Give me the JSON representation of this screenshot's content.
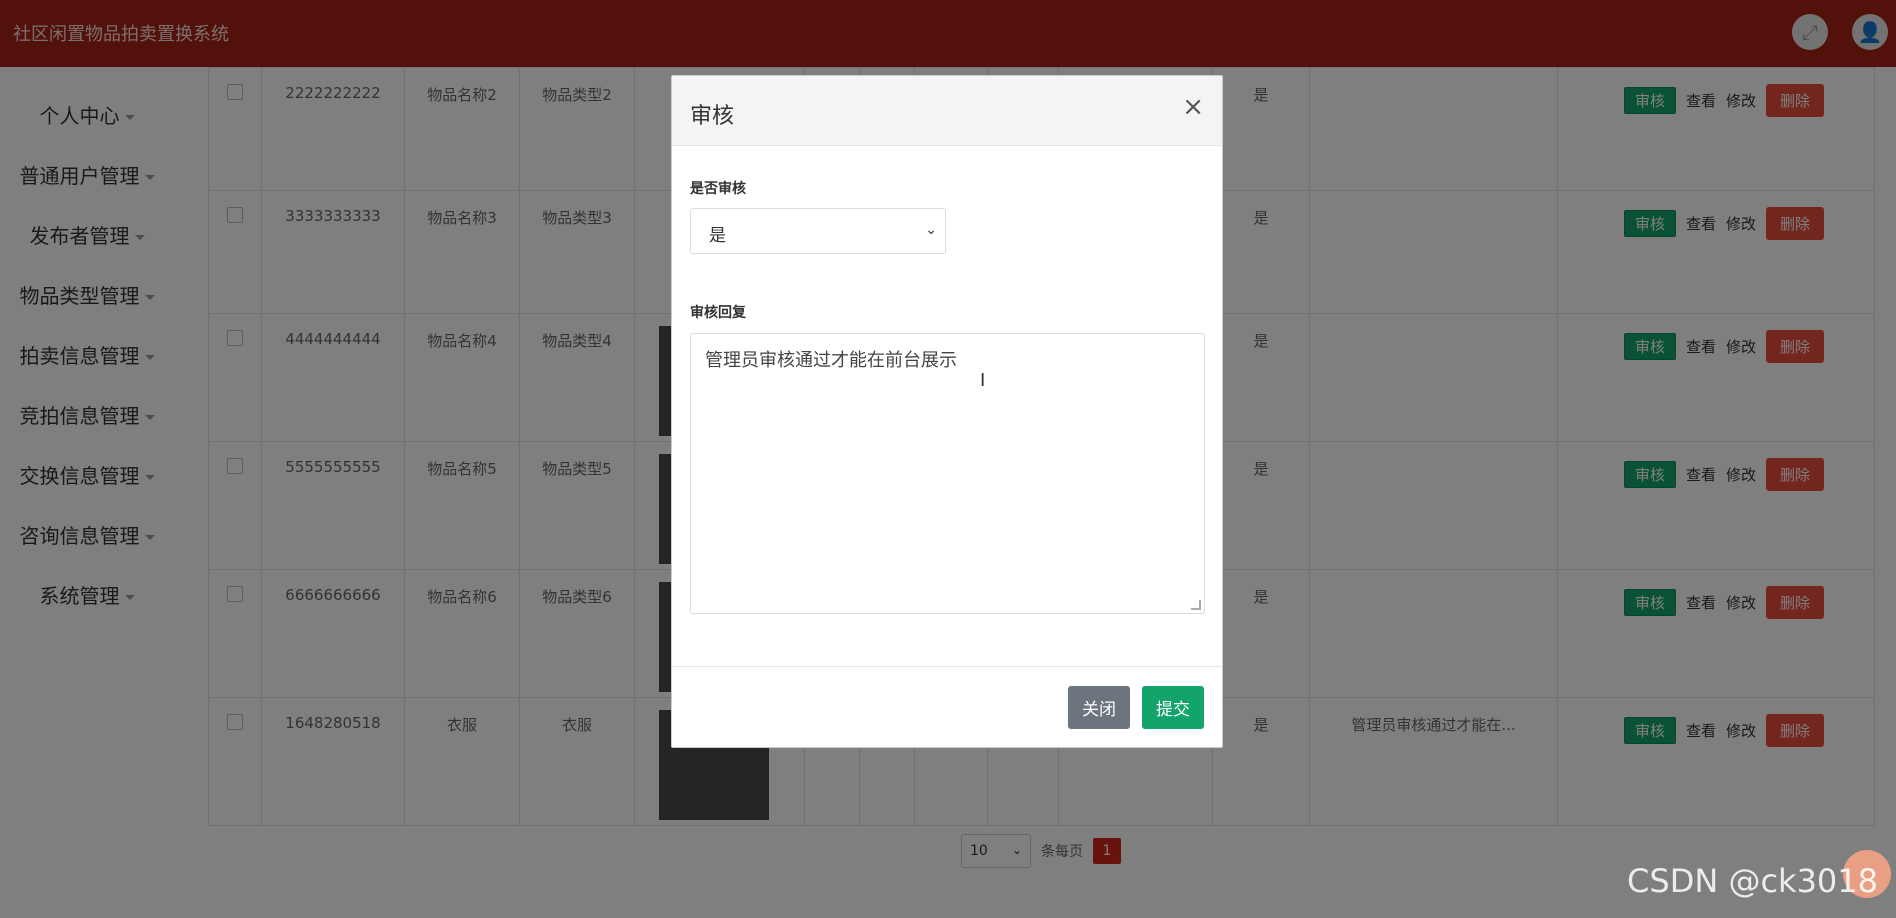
{
  "app": {
    "title": "社区闲置物品拍卖置换系统",
    "theme_color": "#a52316"
  },
  "top_icons": [
    "fullscreen-icon",
    "user-icon"
  ],
  "sidebar": {
    "items": [
      {
        "label": "个人中心"
      },
      {
        "label": "普通用户管理"
      },
      {
        "label": "发布者管理"
      },
      {
        "label": "物品类型管理"
      },
      {
        "label": "拍卖信息管理"
      },
      {
        "label": "竞拍信息管理"
      },
      {
        "label": "交换信息管理"
      },
      {
        "label": "咨询信息管理"
      },
      {
        "label": "系统管理"
      }
    ]
  },
  "table": {
    "rows": [
      {
        "number": "2222222222",
        "name": "物品名称2",
        "type": "物品类型2",
        "audited": "是",
        "reply": "",
        "has_image": false
      },
      {
        "number": "3333333333",
        "name": "物品名称3",
        "type": "物品类型3",
        "audited": "是",
        "reply": "",
        "has_image": false
      },
      {
        "number": "4444444444",
        "name": "物品名称4",
        "type": "物品类型4",
        "audited": "是",
        "reply": "",
        "has_image": true
      },
      {
        "number": "5555555555",
        "name": "物品名称5",
        "type": "物品类型5",
        "audited": "是",
        "reply": "",
        "has_image": true
      },
      {
        "number": "6666666666",
        "name": "物品名称6",
        "type": "物品类型6",
        "audited": "是",
        "reply": "",
        "has_image": true
      },
      {
        "number": "1648280518",
        "name": "衣服",
        "type": "衣服",
        "audited": "是",
        "reply": "管理员审核通过才能在...",
        "has_image": true
      }
    ],
    "actions": {
      "audit": "审核",
      "view": "查看",
      "edit": "修改",
      "delete": "删除"
    }
  },
  "pagination": {
    "page_size": "10",
    "page_size_label": "条每页",
    "current_page": "1"
  },
  "modal": {
    "title": "审核",
    "close_symbol": "×",
    "audit_label": "是否审核",
    "audit_value": "是",
    "reply_label": "审核回复",
    "reply_value": "管理员审核通过才能在前台展示",
    "close_button": "关闭",
    "submit_button": "提交"
  },
  "watermark": "CSDN @ck3018"
}
